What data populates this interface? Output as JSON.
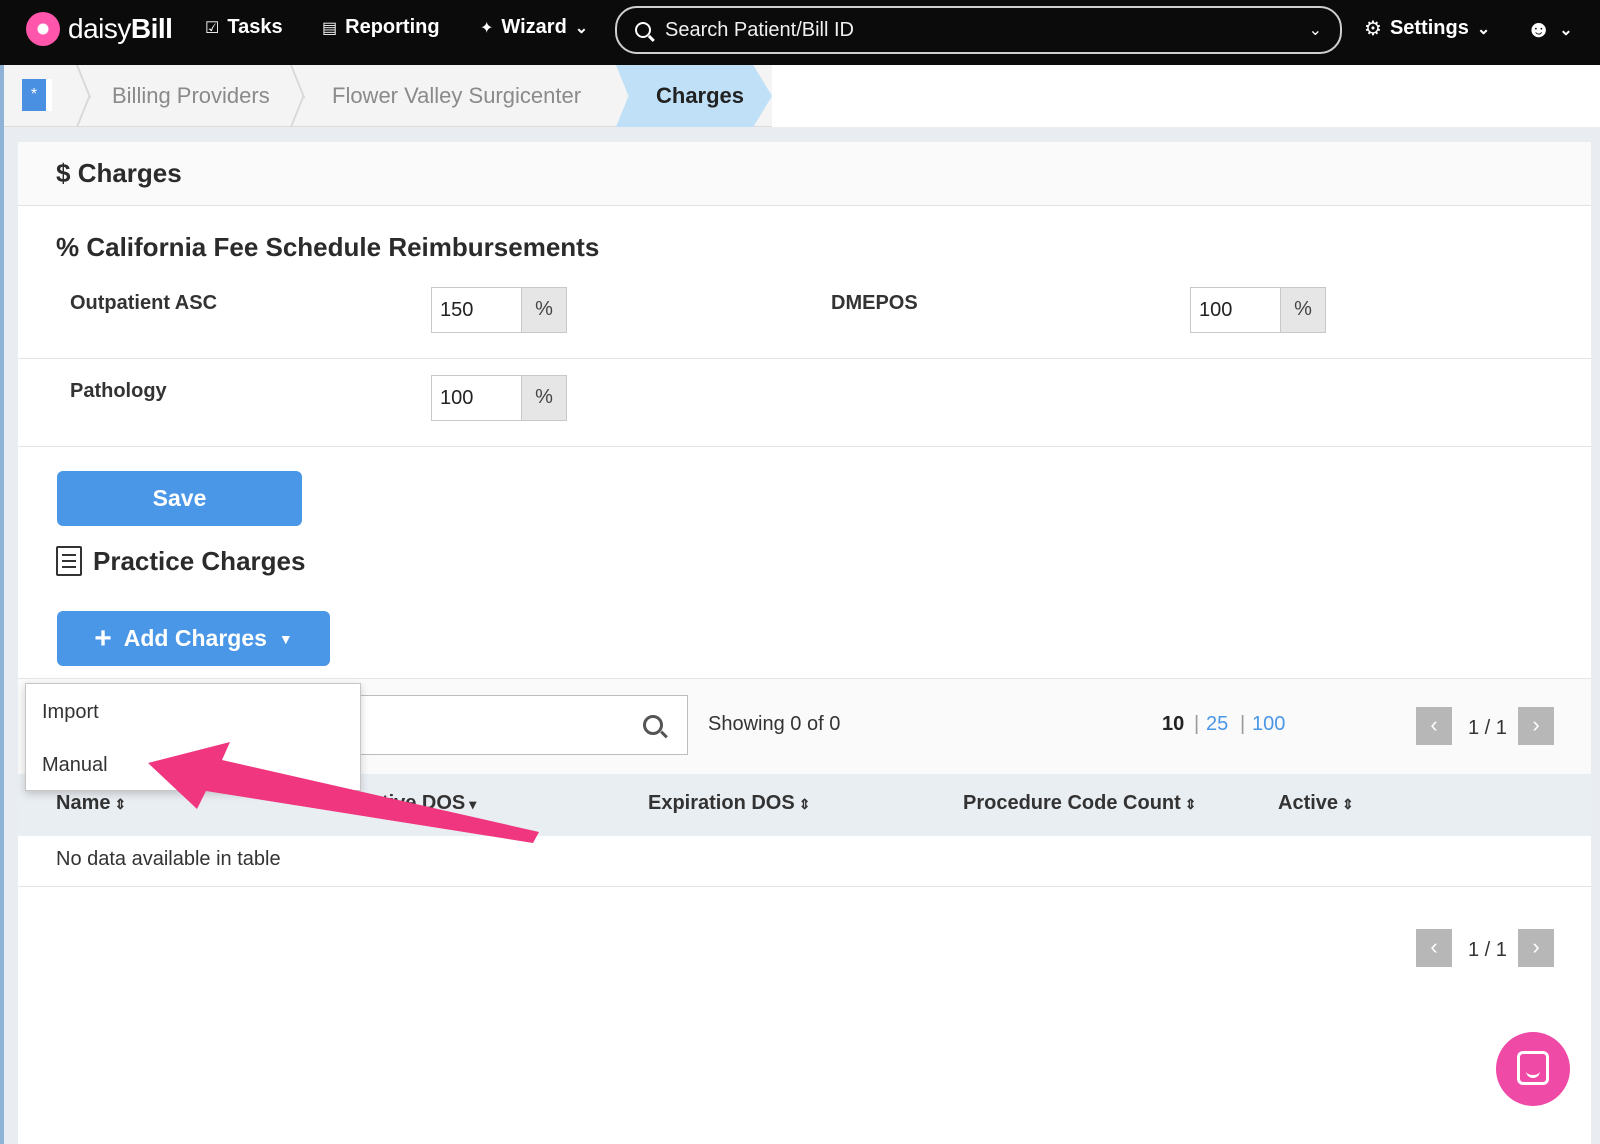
{
  "nav": {
    "logo_light": "daisy",
    "logo_bold": "Bill",
    "tasks": "Tasks",
    "reporting": "Reporting",
    "wizard": "Wizard",
    "search_placeholder": "Search Patient/Bill ID",
    "settings": "Settings"
  },
  "breadcrumb": {
    "items": [
      "Billing Providers",
      "Flower Valley Surgicenter"
    ],
    "active": "Charges"
  },
  "card": {
    "title": "Charges",
    "fee_schedule_title": "California Fee Schedule Reimbursements",
    "fields": {
      "outpatient_asc": {
        "label": "Outpatient ASC",
        "value": "150",
        "unit": "%"
      },
      "dmepos": {
        "label": "DMEPOS",
        "value": "100",
        "unit": "%"
      },
      "pathology": {
        "label": "Pathology",
        "value": "100",
        "unit": "%"
      }
    },
    "save_label": "Save",
    "practice_title": "Practice Charges",
    "add_charges_label": "Add Charges"
  },
  "dropdown": {
    "items": [
      "Import",
      "Manual"
    ]
  },
  "table": {
    "showing": "Showing 0 of 0",
    "page_sizes": [
      "10",
      "25",
      "100"
    ],
    "page_text": "1 / 1",
    "columns": [
      "Name",
      "Effective DOS",
      "Expiration DOS",
      "Procedure Code Count",
      "Active"
    ],
    "empty_text": "No data available in table"
  },
  "colors": {
    "accent": "#4a97e8",
    "annotation_arrow": "#f0367e",
    "chat": "#ef4aa5"
  }
}
